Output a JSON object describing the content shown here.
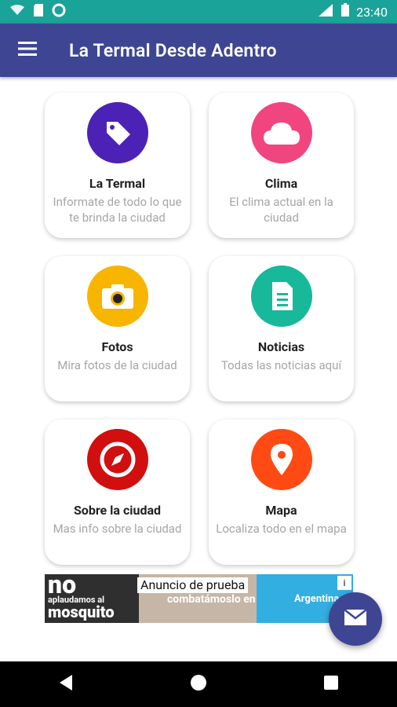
{
  "statusbar": {
    "time": "23:40",
    "network": "LTE"
  },
  "appbar": {
    "title": "La Termal Desde Adentro"
  },
  "cards": [
    {
      "title": "La Termal",
      "desc": "Informate de todo lo que te brinda la ciudad",
      "icon": "tag-icon",
      "color": "#4b22b5"
    },
    {
      "title": "Clima",
      "desc": "El clima actual en la ciudad",
      "icon": "cloud-icon",
      "color": "#f1457f"
    },
    {
      "title": "Fotos",
      "desc": "Mira fotos de la ciudad",
      "icon": "camera-icon",
      "color": "#f7b500"
    },
    {
      "title": "Noticias",
      "desc": "Todas las noticias aquí",
      "icon": "document-icon",
      "color": "#18b89a"
    },
    {
      "title": "Sobre la ciudad",
      "desc": "Mas info sobre la ciudad",
      "icon": "compass-icon",
      "color": "#d10f0f"
    },
    {
      "title": "Mapa",
      "desc": "Localiza todo en el mapa",
      "icon": "map-pin-icon",
      "color": "#ff4a14"
    }
  ],
  "ad": {
    "label": "Anuncio de prueba",
    "left_big": "no",
    "left_small": "aplaudamos al",
    "left_bottom": "mosquito",
    "middle_text": "combatámoslo en serio",
    "right_text": "Argentina"
  },
  "fab": {
    "icon": "mail-icon"
  },
  "navbar": {
    "back": "back-icon",
    "home": "home-icon",
    "recents": "recents-icon"
  }
}
